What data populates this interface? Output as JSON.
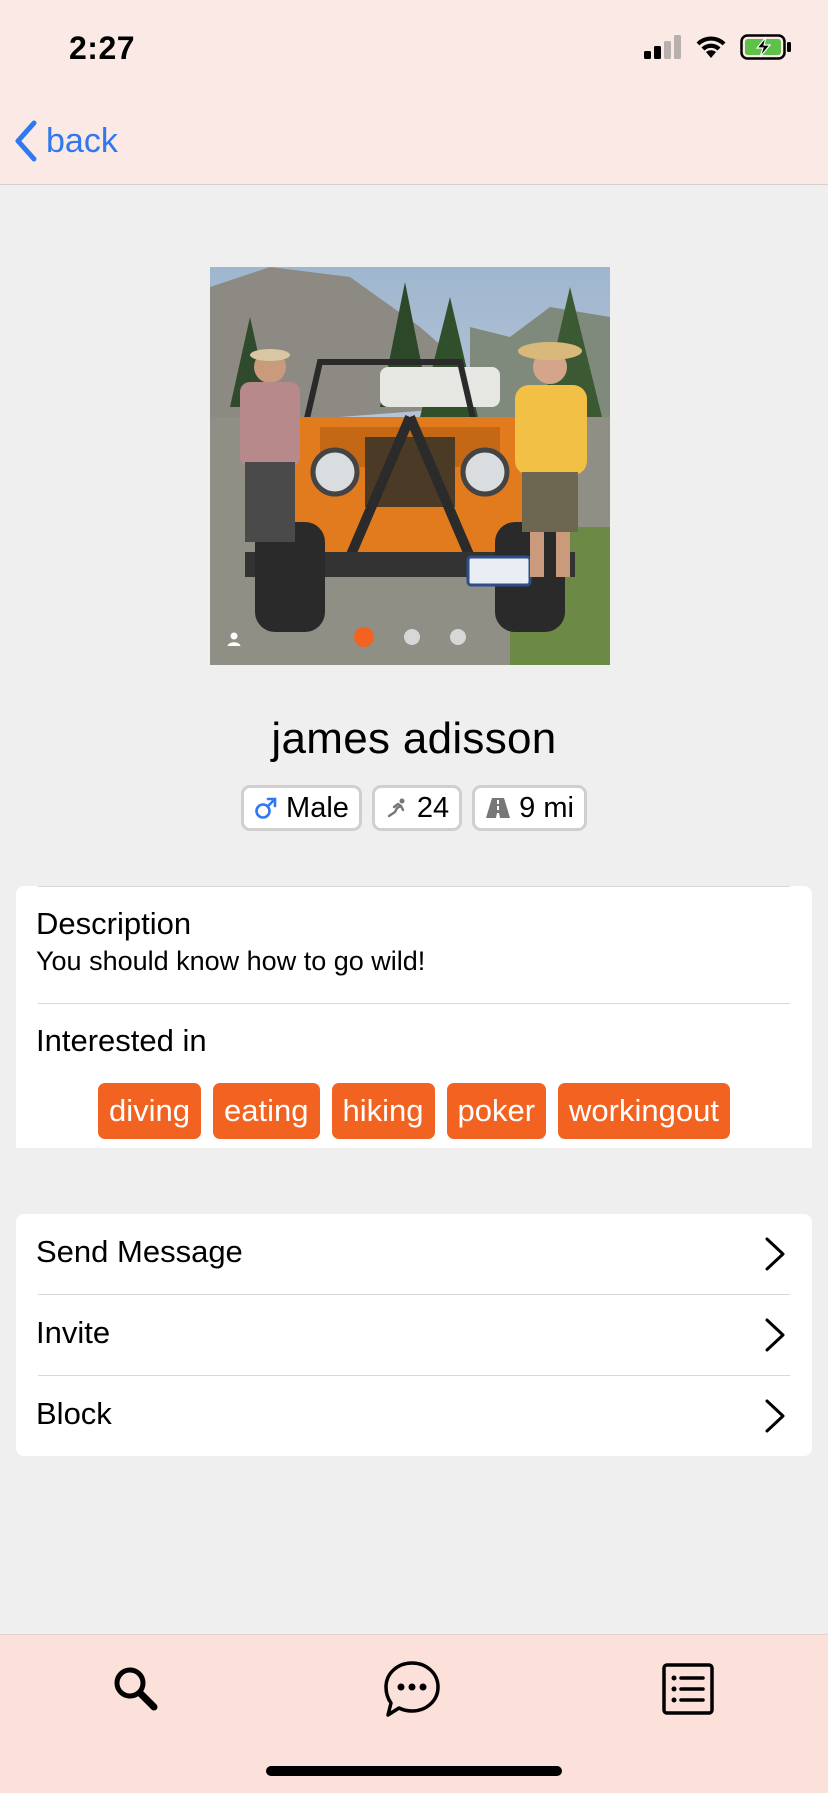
{
  "status_bar": {
    "time": "2:27"
  },
  "nav": {
    "back_label": "back"
  },
  "photo": {
    "slide_count": 3,
    "active_slide": 1
  },
  "profile": {
    "name": "james adisson",
    "gender": "Male",
    "age": "24",
    "distance": "9 mi"
  },
  "details": {
    "description_label": "Description",
    "description_text": "You should know how to go wild!",
    "interests_label": "Interested in",
    "interests": [
      "diving",
      "eating",
      "hiking",
      "poker",
      "workingout"
    ]
  },
  "actions": {
    "send_message": "Send Message",
    "invite": "Invite",
    "block": "Block"
  },
  "tabs": [
    {
      "icon": "search-icon"
    },
    {
      "icon": "chat-bubble-icon"
    },
    {
      "icon": "list-icon"
    }
  ],
  "colors": {
    "accent": "#f26322",
    "link": "#2f78f0",
    "header_bg": "#fbe9e6",
    "tabbar_bg": "#fbe1d9",
    "page_bg": "#efefef"
  }
}
